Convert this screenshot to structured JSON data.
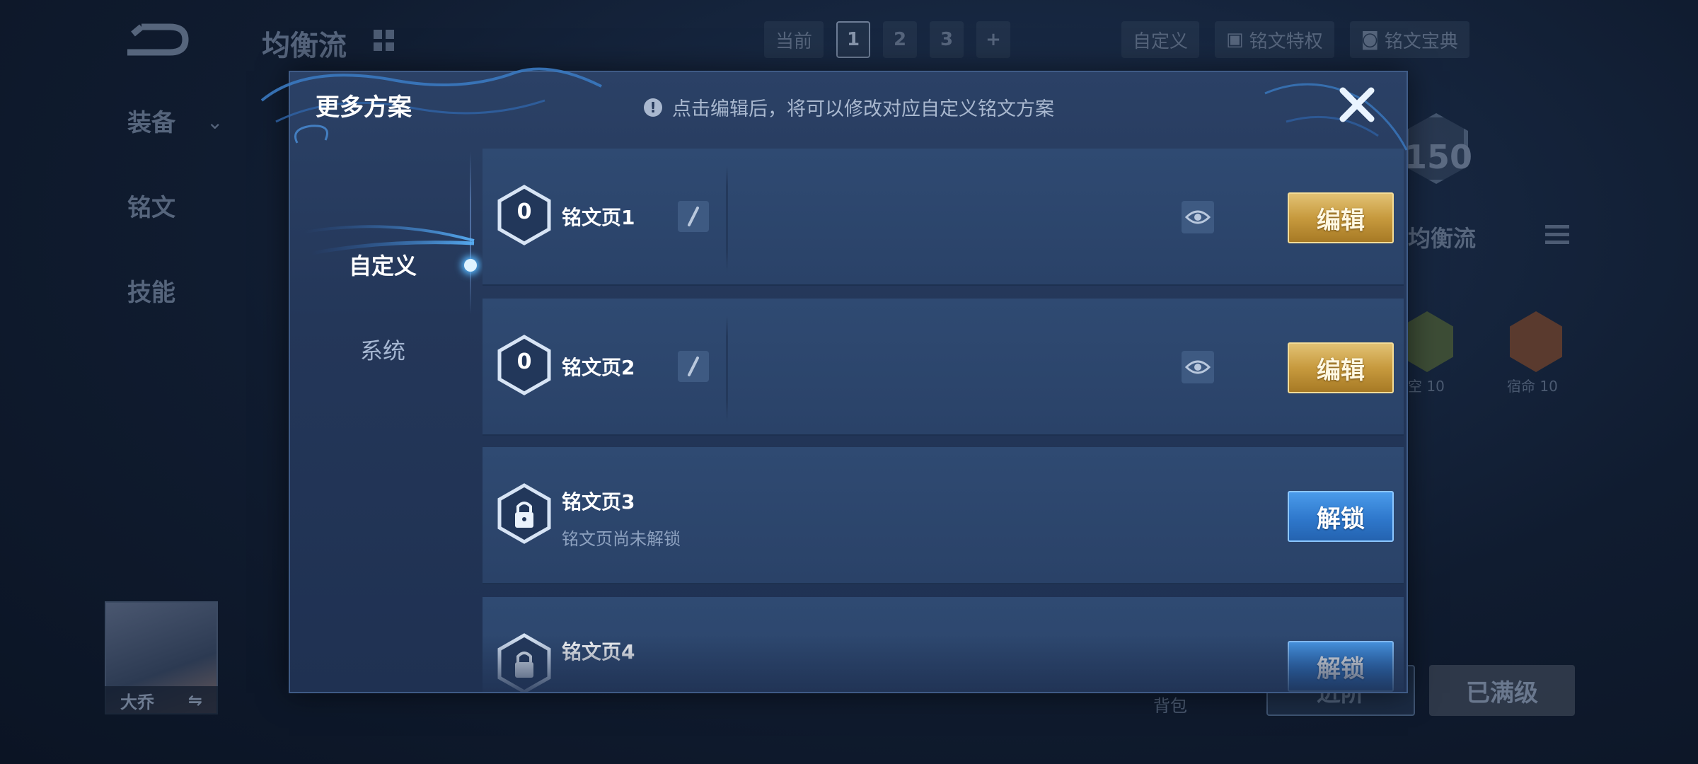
{
  "background": {
    "title": "均衡流",
    "page_tabs": {
      "current_label": "当前",
      "pages": [
        "1",
        "2",
        "3"
      ],
      "add_label": "+"
    },
    "custom_label": "自定义",
    "privilege_label": "铭文特权",
    "encyclopedia_label": "铭文宝典",
    "side_items": [
      "装备",
      "铭文",
      "技能"
    ],
    "level_value": "150",
    "level_label": "均衡流",
    "stats": [
      "空 10",
      "宿命 10"
    ],
    "hero_name": "大乔",
    "bag_label": "背包",
    "upgrade_label": "进阶",
    "maxed_label": "已满级"
  },
  "modal": {
    "title": "更多方案",
    "hint": "点击编辑后，将可以修改对应自定义铭文方案",
    "tabs": [
      {
        "label": "自定义",
        "active": true
      },
      {
        "label": "系统",
        "active": false
      }
    ],
    "pages": [
      {
        "name": "铭文页1",
        "level": "0",
        "locked": false,
        "action": "编辑"
      },
      {
        "name": "铭文页2",
        "level": "0",
        "locked": false,
        "action": "编辑"
      },
      {
        "name": "铭文页3",
        "locked": true,
        "subtitle": "铭文页尚未解锁",
        "action": "解锁"
      },
      {
        "name": "铭文页4",
        "locked": true,
        "action": "解锁"
      }
    ]
  },
  "colors": {
    "accent_gold": "#c79a3e",
    "accent_blue": "#2f78cc",
    "modal_bg": "#243759"
  }
}
